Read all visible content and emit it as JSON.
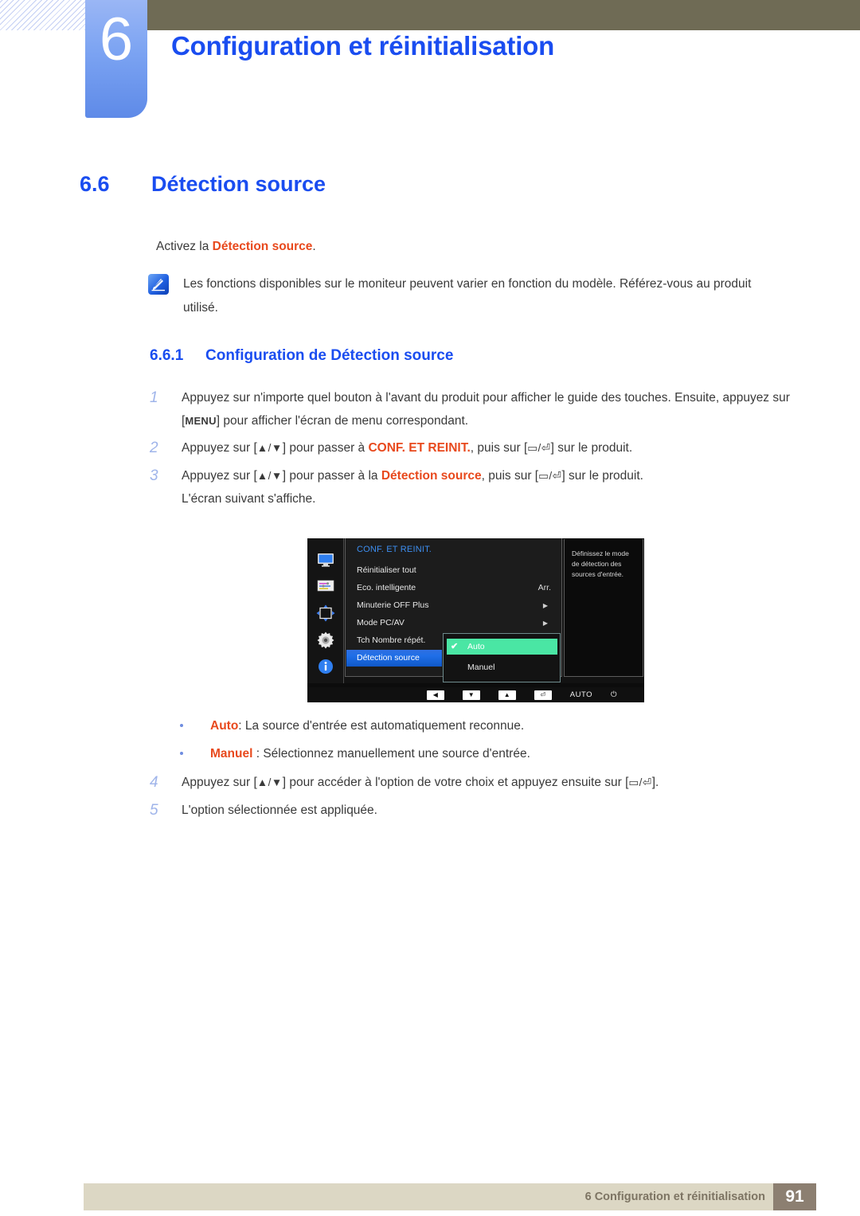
{
  "banner": {
    "chapter_number": "6",
    "title": "Configuration et réinitialisation"
  },
  "section": {
    "number": "6.6",
    "title": "Détection source",
    "lead_prefix": "Activez la ",
    "lead_highlight": "Détection source",
    "lead_suffix": "."
  },
  "note": {
    "icon": "note-pen-icon",
    "text": "Les fonctions disponibles sur le moniteur peuvent varier en fonction du modèle. Référez-vous au produit utilisé."
  },
  "subsection": {
    "number": "6.6.1",
    "title": "Configuration de Détection source"
  },
  "steps": [
    {
      "n": "1",
      "parts": [
        {
          "t": "text",
          "v": "Appuyez sur n'importe quel bouton à l'avant du produit pour afficher le guide des touches. Ensuite, appuyez sur ["
        },
        {
          "t": "key",
          "v": "MENU"
        },
        {
          "t": "text",
          "v": "] pour afficher l'écran de menu correspondant."
        }
      ]
    },
    {
      "n": "2",
      "parts": [
        {
          "t": "text",
          "v": "Appuyez sur ["
        },
        {
          "t": "glyph",
          "v": "▲/▼"
        },
        {
          "t": "text",
          "v": "] pour passer à "
        },
        {
          "t": "orange",
          "v": "CONF. ET REINIT."
        },
        {
          "t": "text",
          "v": ", puis sur ["
        },
        {
          "t": "glyph",
          "v": "▭/⏎"
        },
        {
          "t": "text",
          "v": "] sur le produit."
        }
      ]
    },
    {
      "n": "3",
      "parts": [
        {
          "t": "text",
          "v": "Appuyez sur ["
        },
        {
          "t": "glyph",
          "v": "▲/▼"
        },
        {
          "t": "text",
          "v": "] pour passer à la "
        },
        {
          "t": "orange",
          "v": "Détection source"
        },
        {
          "t": "text",
          "v": ", puis sur ["
        },
        {
          "t": "glyph",
          "v": "▭/⏎"
        },
        {
          "t": "text",
          "v": "] sur le produit."
        }
      ],
      "continuation": "L'écran suivant s'affiche."
    },
    {
      "n": "4",
      "parts": [
        {
          "t": "text",
          "v": "Appuyez sur ["
        },
        {
          "t": "glyph",
          "v": "▲/▼"
        },
        {
          "t": "text",
          "v": "] pour accéder à l'option de votre choix et appuyez ensuite sur ["
        },
        {
          "t": "glyph",
          "v": "▭/⏎"
        },
        {
          "t": "text",
          "v": "]."
        }
      ]
    },
    {
      "n": "5",
      "parts": [
        {
          "t": "text",
          "v": "L'option sélectionnée est appliquée."
        }
      ]
    }
  ],
  "osd": {
    "rail_icons": [
      "monitor-icon",
      "image-sliders-icon",
      "size-position-icon",
      "gear-icon",
      "info-icon"
    ],
    "menu_title": "CONF. ET REINIT.",
    "rows": [
      {
        "label": "Réinitialiser tout",
        "value": "",
        "arrow": false
      },
      {
        "label": "Eco. intelligente",
        "value": "Arr.",
        "arrow": false
      },
      {
        "label": "Minuterie OFF Plus",
        "value": "",
        "arrow": true
      },
      {
        "label": "Mode PC/AV",
        "value": "",
        "arrow": true
      },
      {
        "label": "Tch Nombre répét.",
        "value": "",
        "arrow": false
      },
      {
        "label": "Détection source",
        "value": "",
        "arrow": false,
        "selected": true
      }
    ],
    "submenu": [
      {
        "label": "Auto",
        "checked": true
      },
      {
        "label": "Manuel",
        "checked": false
      }
    ],
    "help_text": "Définissez le mode de détection des sources d'entrée.",
    "bottom_bar": {
      "keys": [
        "◀",
        "▼",
        "▲",
        "⏎"
      ],
      "auto_label": "AUTO",
      "power_icon": "power-icon"
    },
    "colors": {
      "title_blue": "#3d8ef0",
      "row_highlight": "#1f6fe8",
      "submenu_highlight": "#4ae6a4"
    }
  },
  "bullets": [
    {
      "term": "Auto",
      "sep": ": ",
      "text": "La source d'entrée est automatiquement reconnue."
    },
    {
      "term": "Manuel",
      "sep": " : ",
      "text": "Sélectionnez manuellement une source d'entrée."
    }
  ],
  "footer": {
    "text": "6 Configuration et réinitialisation",
    "page": "91"
  }
}
